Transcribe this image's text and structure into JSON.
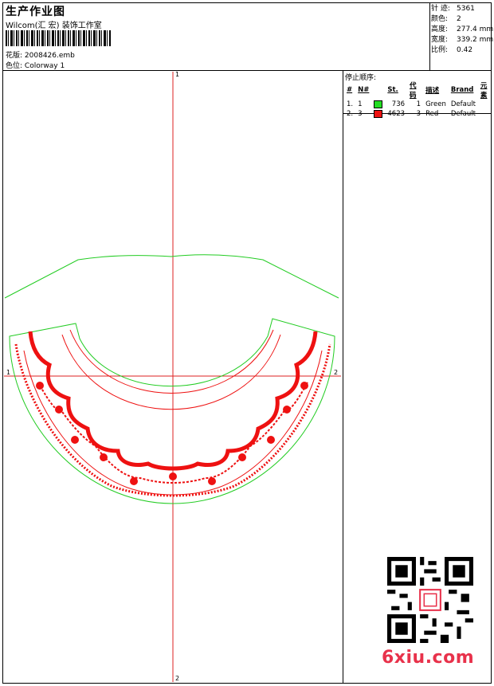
{
  "header": {
    "title": "生产作业图",
    "subtitle": "Wilcom(汇 宏) 装饰工作室",
    "design_file_label": "花版:",
    "design_file": "2008426.emb",
    "colorway_label": "色位:",
    "colorway": "Colorway 1"
  },
  "stats": {
    "stitches_label": "针 迹:",
    "stitches": "5361",
    "colors_label": "颜色:",
    "colors": "2",
    "height_label": "高度:",
    "height": "277.4 mm",
    "width_label": "宽度:",
    "width": "339.2 mm",
    "scale_label": "比例:",
    "scale": "0.42"
  },
  "stop_sequence": {
    "title": "停止顺序:",
    "columns": [
      "#",
      "N#",
      "St.",
      "代码",
      "描述",
      "Brand",
      "元素"
    ],
    "rows": [
      {
        "idx": "1.",
        "needle": "1",
        "color": "#22dd22",
        "stitches": "736",
        "code": "1",
        "desc": "Green",
        "brand": "Default"
      },
      {
        "idx": "2.",
        "needle": "3",
        "color": "#ee1111",
        "stitches": "4623",
        "code": "3",
        "desc": "Red",
        "brand": "Default"
      }
    ]
  },
  "axes": {
    "top": "1",
    "bottom": "2",
    "left": "1",
    "right": "2"
  },
  "watermark": "6xiu.com"
}
